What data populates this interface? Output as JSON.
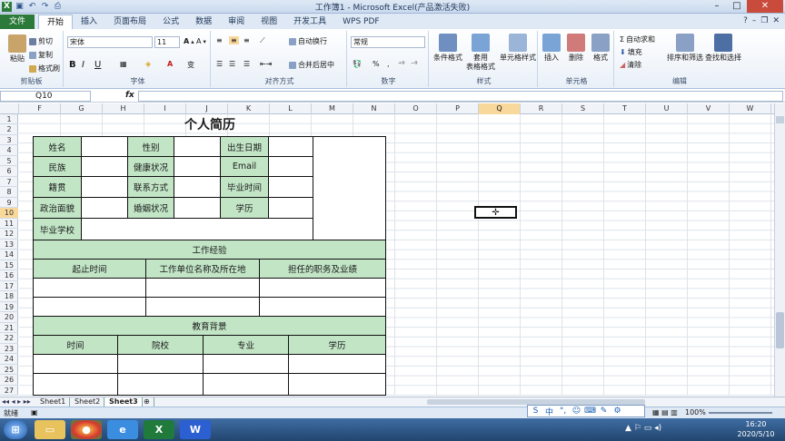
{
  "window": {
    "title": "工作簿1 - Microsoft Excel(产品激活失败)"
  },
  "ribbon_tabs": [
    "文件",
    "开始",
    "插入",
    "页面布局",
    "公式",
    "数据",
    "审阅",
    "视图",
    "开发工具",
    "WPS PDF"
  ],
  "clipboard": {
    "cut": "剪切",
    "copy": "复制",
    "paste": "粘贴",
    "format_painter": "格式刷",
    "label": "剪贴板"
  },
  "font": {
    "name": "宋体",
    "size": "11",
    "bold": "B",
    "italic": "I",
    "underline": "U",
    "label": "字体"
  },
  "alignment": {
    "wrap": "自动换行",
    "merge": "合并后居中",
    "label": "对齐方式"
  },
  "number": {
    "format": "常规",
    "label": "数字"
  },
  "styles": {
    "conditional": "条件格式",
    "table": "套用\n表格格式",
    "cell": "单元格样式",
    "label": "样式"
  },
  "cells": {
    "insert": "插入",
    "delete": "删除",
    "format": "格式",
    "label": "单元格"
  },
  "editing": {
    "autosum": "自动求和",
    "fill": "填充",
    "clear": "清除",
    "sort": "排序和筛选",
    "find": "查找和选择",
    "label": "编辑"
  },
  "name_box": "Q10",
  "fx": "fx",
  "columns": [
    "F",
    "G",
    "H",
    "I",
    "J",
    "K",
    "L",
    "M",
    "N",
    "O",
    "P",
    "Q",
    "R",
    "S",
    "T",
    "U",
    "V",
    "W"
  ],
  "selected_column": "Q",
  "rows": [
    "1",
    "2",
    "3",
    "4",
    "5",
    "6",
    "7",
    "8",
    "9",
    "10",
    "11",
    "12",
    "13",
    "14",
    "15",
    "16",
    "17",
    "18",
    "19",
    "20",
    "21",
    "22",
    "23",
    "24",
    "25",
    "26",
    "27"
  ],
  "selected_row": "10",
  "resume": {
    "title": "个人简历",
    "labels": {
      "name": "姓名",
      "gender": "性别",
      "birth": "出生日期",
      "ethnic": "民族",
      "health": "健康状况",
      "email": "Email",
      "native": "籍贯",
      "contact": "联系方式",
      "grad_time": "毕业时间",
      "political": "政治面貌",
      "marital": "婚姻状况",
      "degree": "学历",
      "school": "毕业学校"
    },
    "work_header": "工作经验",
    "work_cols": [
      "起止时间",
      "工作单位名称及所在地",
      "担任的职务及业绩"
    ],
    "edu_header": "教育背景",
    "edu_cols": [
      "时间",
      "院校",
      "专业",
      "学历"
    ]
  },
  "sheets": [
    "Sheet1",
    "Sheet2",
    "Sheet3"
  ],
  "active_sheet": "Sheet3",
  "status": {
    "ready": "就绪",
    "zoom": "100%"
  },
  "clock": {
    "time": "16:20",
    "date": "2020/5/10"
  },
  "ime": {
    "mode": "中"
  },
  "colors": {
    "green_cell": "#c2e5c6",
    "file_tab": "#2b7a3a",
    "selection": "#f9d99b"
  }
}
